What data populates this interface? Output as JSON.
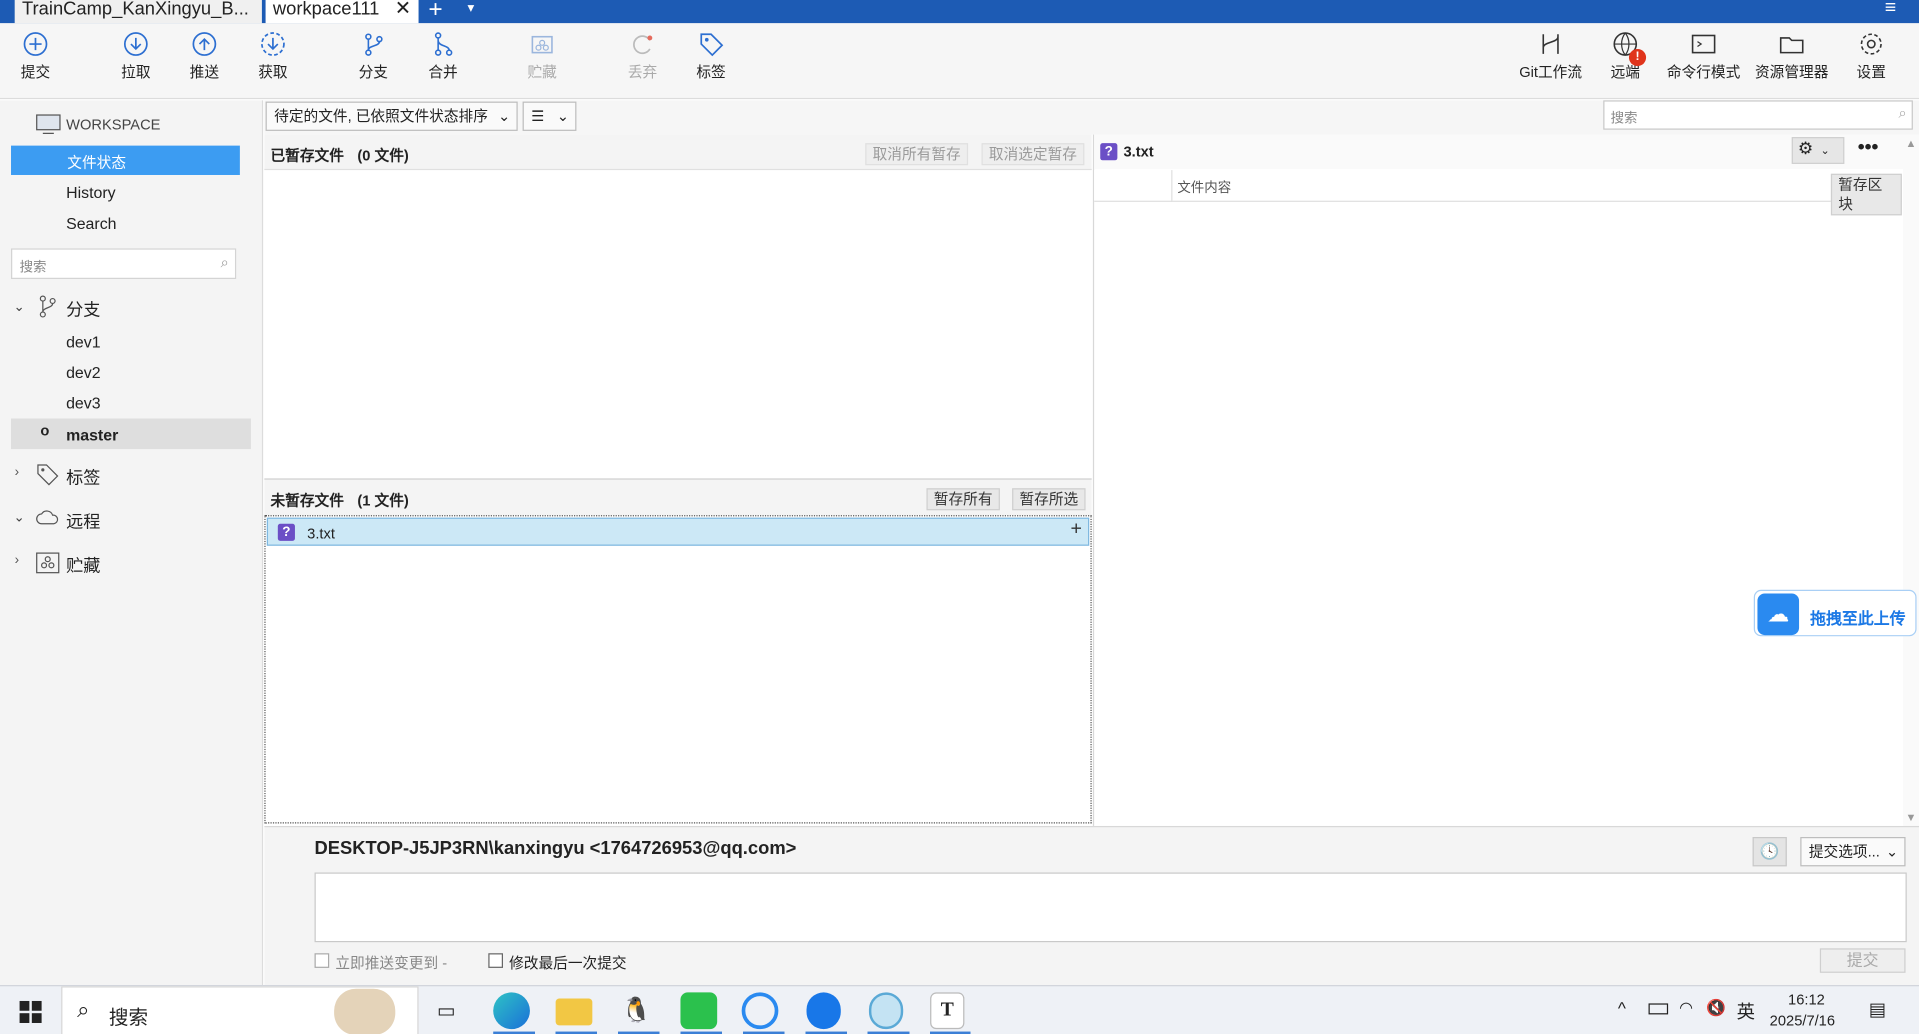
{
  "tabs": [
    {
      "label": "TrainCamp_KanXingyu_B..."
    },
    {
      "label": "workpace111"
    }
  ],
  "toolbar": {
    "commit": "提交",
    "pull": "拉取",
    "push": "推送",
    "fetch": "获取",
    "branch": "分支",
    "merge": "合并",
    "stash": "贮藏",
    "discard": "丢弃",
    "tag": "标签",
    "git_flow": "Git工作流",
    "remote": "远端",
    "terminal": "命令行模式",
    "explorer": "资源管理器",
    "settings": "设置"
  },
  "sidebar": {
    "workspace": "WORKSPACE",
    "file_status": "文件状态",
    "history": "History",
    "search": "Search",
    "search_placeholder": "搜索",
    "branches_label": "分支",
    "branches": [
      "dev1",
      "dev2",
      "dev3",
      "master"
    ],
    "tags_label": "标签",
    "remotes_label": "远程",
    "stashes_label": "贮藏"
  },
  "filter": {
    "sort_label": "待定的文件, 已依照文件状态排序",
    "search_placeholder": "搜索"
  },
  "staged": {
    "title": "已暂存文件",
    "count": "(0 文件)",
    "unstage_all": "取消所有暂存",
    "unstage_selected": "取消选定暂存"
  },
  "unstaged": {
    "title": "未暂存文件",
    "count": "(1 文件)",
    "stage_all": "暂存所有",
    "stage_selected": "暂存所选",
    "files": [
      {
        "name": "3.txt"
      }
    ]
  },
  "diff": {
    "file": "3.txt",
    "content_header": "文件内容",
    "stage_hunk": "暂存区块"
  },
  "upload_widget": "拖拽至此上传",
  "commit": {
    "author": "DESKTOP-J5JP3RN\\kanxingyu <1764726953@qq.com>",
    "options": "提交选项...",
    "push_now": "立即推送变更到 -",
    "amend": "修改最后一次提交",
    "submit": "提交"
  },
  "taskbar": {
    "search": "搜索",
    "ime": "英",
    "time": "16:12",
    "date": "2025/7/16"
  }
}
